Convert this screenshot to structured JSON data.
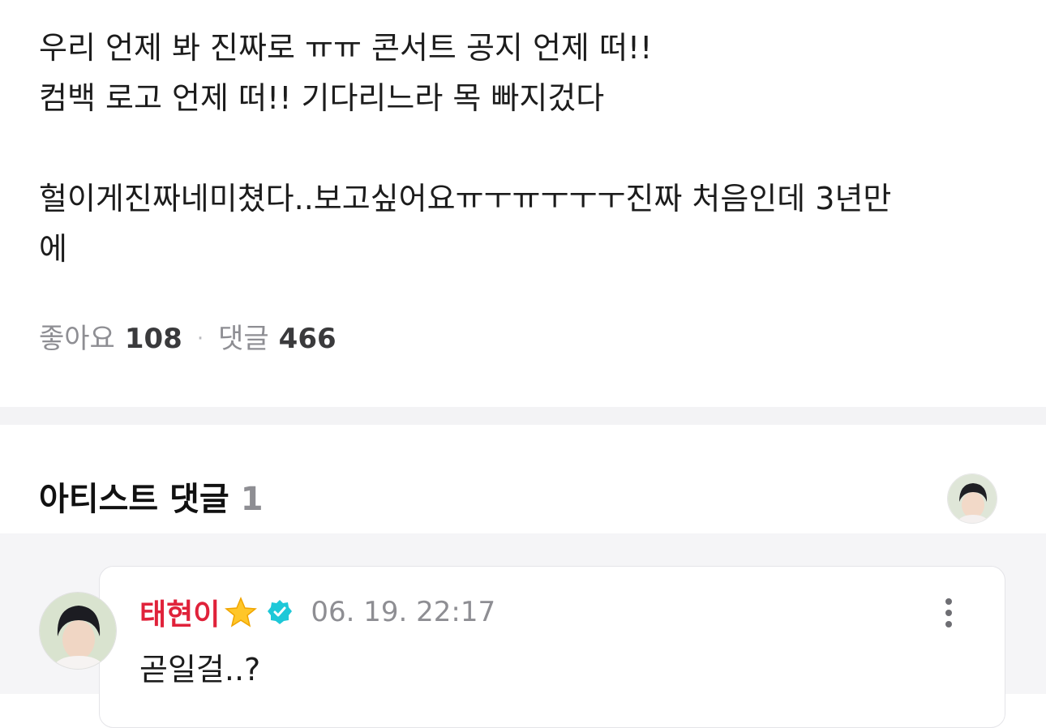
{
  "post": {
    "lines": [
      "우리 언제 봐 진짜로 ㅠㅠ 콘서트 공지 언제 떠!!",
      "컴백 로고 언제 떠!! 기다리느라 목 빠지겄다",
      "헐이게진짜네미쳤다..보고싶어요ㅠㅜㅠㅜㅜㅜ진짜 처음인데 3년만",
      "에"
    ]
  },
  "stats": {
    "likes_label": "좋아요",
    "likes_count": "108",
    "separator": "·",
    "comments_label": "댓글",
    "comments_count": "466"
  },
  "artist_comments": {
    "title": "아티스트 댓글",
    "count": "1",
    "header_avatar_icon": "artist-avatar",
    "comment": {
      "author": "태현이",
      "author_color": "#e0223a",
      "badge_icon": "star-icon",
      "verified_icon": "verified-check-icon",
      "verified_color": "#1ec8d8",
      "timestamp": "06. 19. 22:17",
      "text": "곧일걸..?",
      "menu_icon": "more-vertical-icon"
    }
  }
}
